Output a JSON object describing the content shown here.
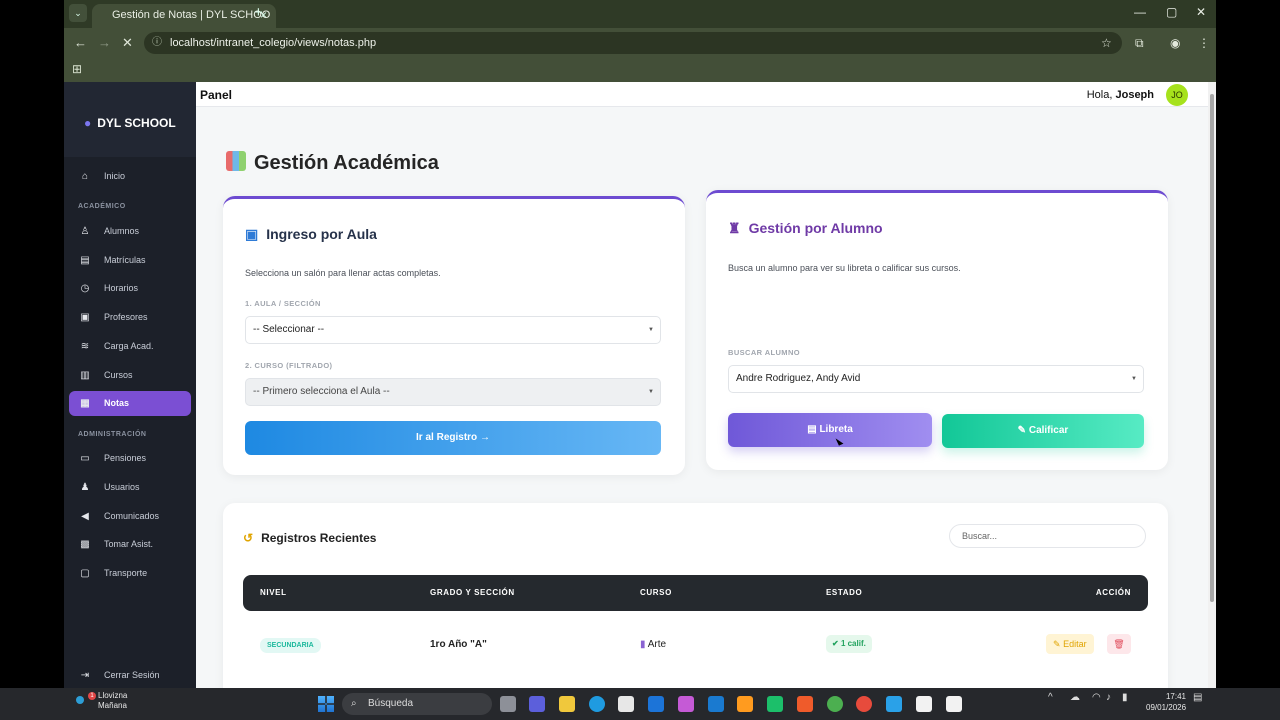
{
  "browser": {
    "tab_title": "Gestión de Notas | DYL SCHOO",
    "tab_close": "×",
    "new_tab": "+",
    "url": "localhost/intranet_colegio/views/notas.php",
    "nav_icons": [
      "back-arrow",
      "forward-arrow",
      "stop-loading",
      "star",
      "extensions",
      "profile",
      "menu"
    ],
    "window_controls": [
      "—",
      "▢",
      "✕"
    ]
  },
  "sidebar": {
    "brand": "DYL SCHOOL",
    "sections": [
      {
        "title": "",
        "items": [
          {
            "label": "Inicio",
            "icon": "home-icon",
            "active": false
          }
        ]
      },
      {
        "title": "ACADÉMICO",
        "items": [
          {
            "label": "Alumnos",
            "icon": "students-icon",
            "active": false
          },
          {
            "label": "Matrículas",
            "icon": "id-card-icon",
            "active": false
          },
          {
            "label": "Horarios",
            "icon": "clock-icon",
            "active": false
          },
          {
            "label": "Profesores",
            "icon": "teacher-icon",
            "active": false
          },
          {
            "label": "Carga Acad.",
            "icon": "layers-icon",
            "active": false
          },
          {
            "label": "Cursos",
            "icon": "book-icon",
            "active": false
          },
          {
            "label": "Notas",
            "icon": "clipboard-icon",
            "active": true
          }
        ]
      },
      {
        "title": "ADMINISTRACIÓN",
        "items": [
          {
            "label": "Pensiones",
            "icon": "money-icon",
            "active": false
          },
          {
            "label": "Usuarios",
            "icon": "users-icon",
            "active": false
          },
          {
            "label": "Comunicados",
            "icon": "megaphone-icon",
            "active": false
          },
          {
            "label": "Tomar Asist.",
            "icon": "calendar-check-icon",
            "active": false
          },
          {
            "label": "Transporte",
            "icon": "bus-icon",
            "active": false
          }
        ]
      }
    ],
    "logout": "Cerrar Sesión"
  },
  "topbar": {
    "title": "Panel",
    "greeting_prefix": "Hola, ",
    "user_name": "Joseph",
    "avatar_initials": "JO"
  },
  "page": {
    "title": "Gestión Académica"
  },
  "aula_card": {
    "title": "Ingreso por Aula",
    "description": "Selecciona un salón para llenar actas completas.",
    "label_aula": "1. AULA / SECCIÓN",
    "aula_value": "-- Seleccionar --",
    "label_curso": "2. CURSO (FILTRADO)",
    "curso_value": "-- Primero selecciona el Aula --",
    "button": "Ir al Registro"
  },
  "alumno_card": {
    "title": "Gestión por Alumno",
    "description": "Busca un alumno para ver su libreta o calificar sus cursos.",
    "label": "BUSCAR ALUMNO",
    "student_value": "Andre Rodriguez, Andy Avid",
    "button_libreta": "Libreta",
    "button_calificar": "Calificar"
  },
  "records": {
    "title": "Registros Recientes",
    "search_placeholder": "Buscar...",
    "columns": [
      "NIVEL",
      "GRADO Y SECCIÓN",
      "CURSO",
      "ESTADO",
      "ACCIÓN"
    ],
    "rows": [
      {
        "nivel": "SECUNDARIA",
        "grado": "1ro Año \"A\"",
        "curso": "Arte",
        "estado": "1 calif.",
        "editar": "Editar"
      }
    ]
  },
  "taskbar": {
    "weather_line1": "Llovizna",
    "weather_line2": "Mañana",
    "notification_count": "1",
    "search_placeholder": "Búsqueda",
    "time": "17:41",
    "date": "09/01/2026"
  },
  "colors": {
    "accent": "#7b4fd3",
    "sidebar": "#1c2029",
    "blue_button": "#1e89e2",
    "purple_button": "#6f58d8",
    "green_button": "#12c797"
  }
}
